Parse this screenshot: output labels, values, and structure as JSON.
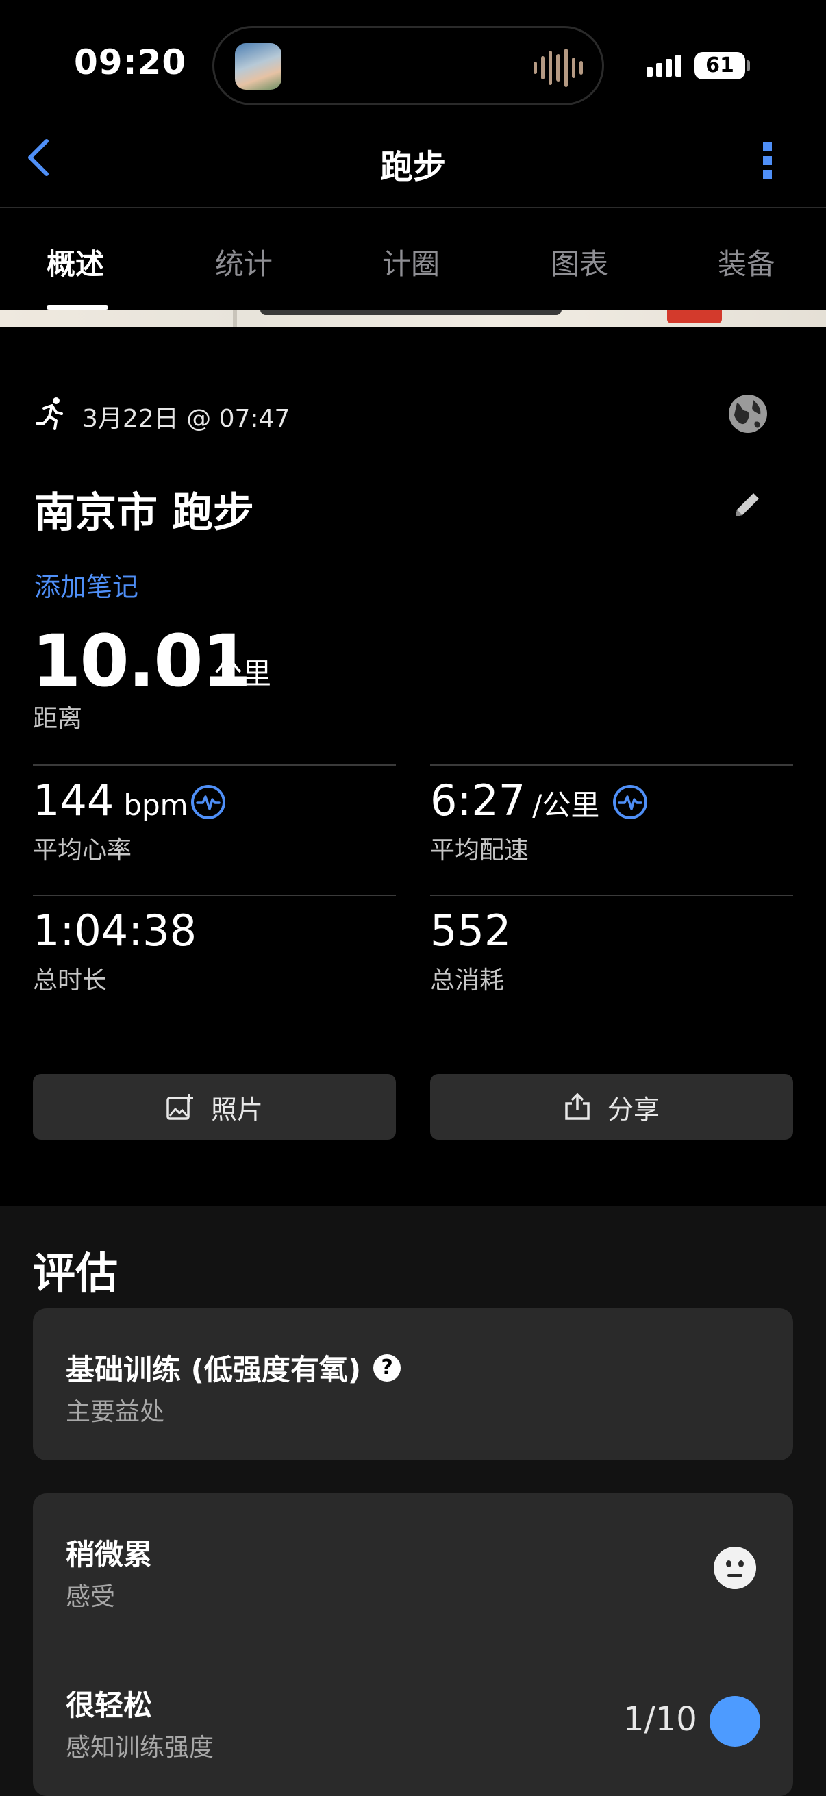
{
  "status_bar": {
    "time": "09:20",
    "battery": "61"
  },
  "header": {
    "title": "跑步"
  },
  "tabs": [
    {
      "label": "概述",
      "active": true
    },
    {
      "label": "统计",
      "active": false
    },
    {
      "label": "计圈",
      "active": false
    },
    {
      "label": "图表",
      "active": false
    },
    {
      "label": "装备",
      "active": false
    }
  ],
  "activity": {
    "datetime": "3月22日 @ 07:47",
    "title": "南京市 跑步",
    "add_note": "添加笔记",
    "distance": {
      "value": "10.01",
      "unit": "公里",
      "label": "距离"
    },
    "stats": {
      "avg_hr": {
        "value": "144",
        "unit": "bpm",
        "label": "平均心率"
      },
      "avg_pace": {
        "value": "6:27",
        "unit": "/公里",
        "label": "平均配速"
      },
      "total_time": {
        "value": "1:04:38",
        "label": "总时长"
      },
      "calories": {
        "value": "552",
        "label": "总消耗"
      }
    },
    "buttons": {
      "photo": "照片",
      "share": "分享"
    }
  },
  "evaluation": {
    "title": "评估",
    "training_effect": {
      "main": "基础训练 (低强度有氧)",
      "sub": "主要益处",
      "help": "?"
    },
    "feel": {
      "main": "稍微累",
      "sub": "感受"
    },
    "rpe": {
      "main": "很轻松",
      "sub": "感知训练强度",
      "value": "1/10"
    }
  },
  "colors": {
    "accent": "#4f8ff7",
    "rpe_dot": "#4d9bff",
    "background": "#000000",
    "card": "#2a2a2a"
  }
}
